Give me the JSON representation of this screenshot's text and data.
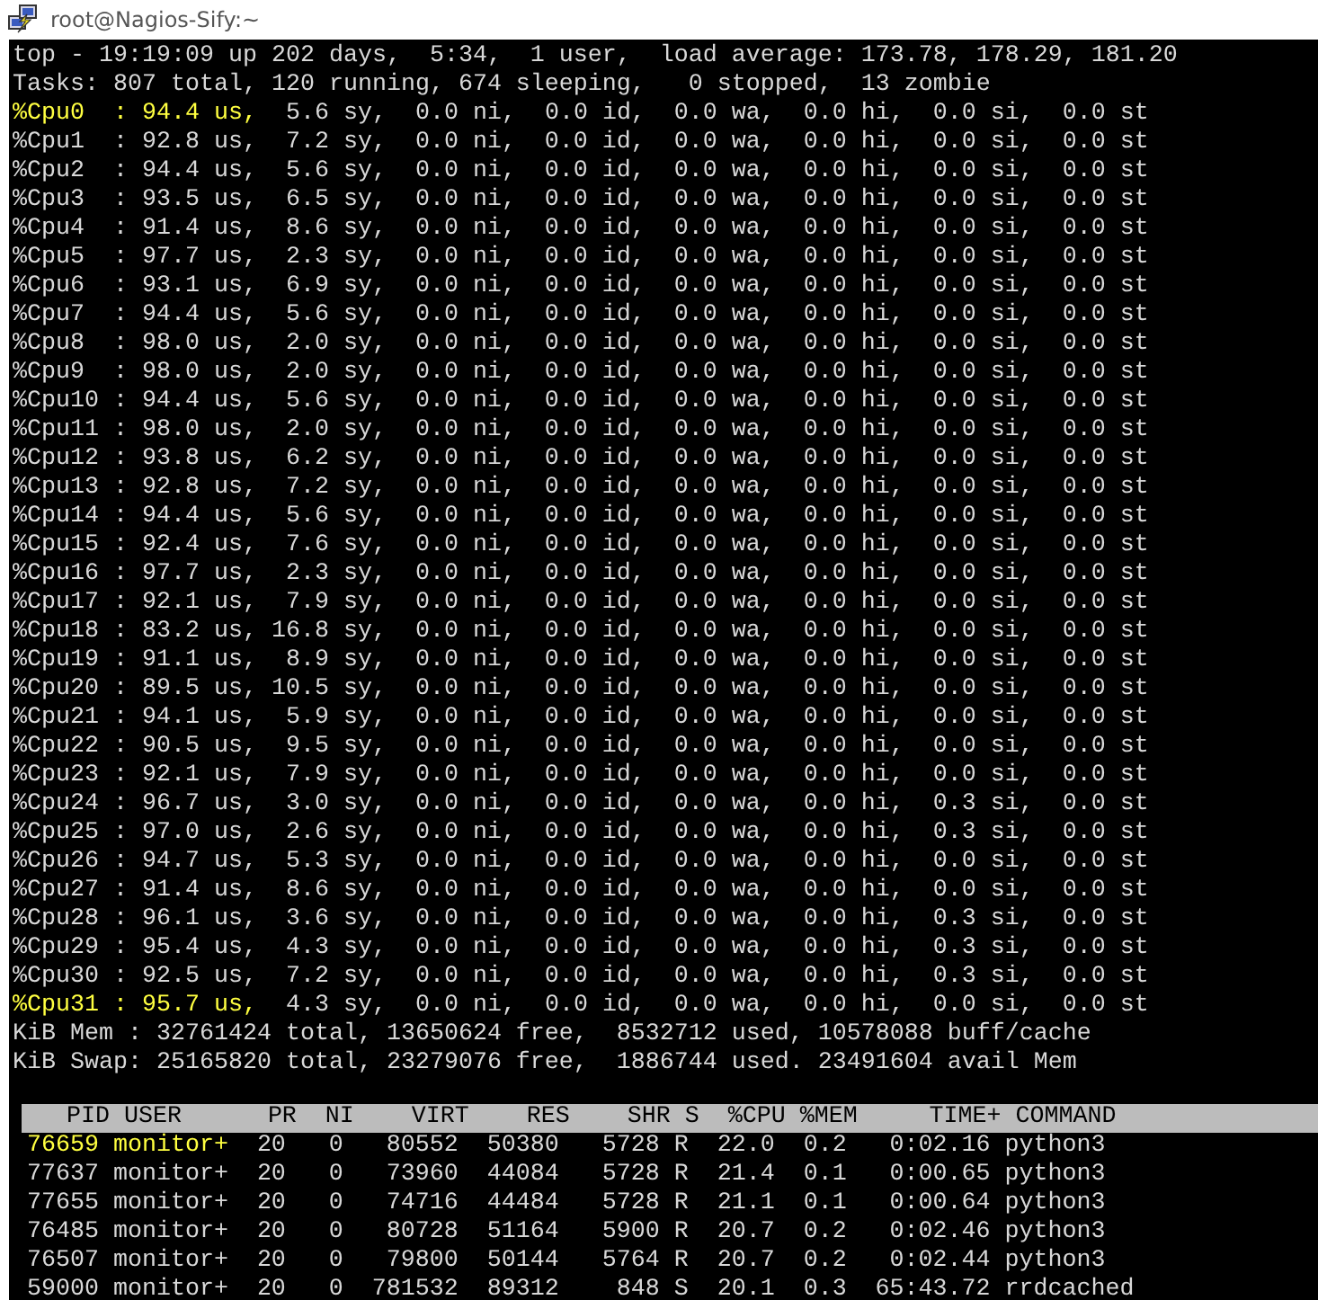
{
  "window": {
    "title": "root@Nagios-Sify:~"
  },
  "summary_lines": [
    {
      "segments": [
        {
          "text": "top - 19:19:09 up 202 days,  5:34,  1 user,  load average: 173.78, 178.29, 181.20",
          "highlighted": false
        }
      ]
    },
    {
      "segments": [
        {
          "text": "Tasks: 807 total, 120 running, 674 sleeping,   0 stopped,  13 zombie",
          "highlighted": false
        }
      ]
    },
    {
      "segments": [
        {
          "text": "%Cpu0  : 94.4 us,",
          "highlighted": true
        },
        {
          "text": "  5.6 sy,  0.0 ni,  0.0 id,  0.0 wa,  0.0 hi,  0.0 si,  0.0 st",
          "highlighted": false
        }
      ]
    },
    {
      "segments": [
        {
          "text": "%Cpu1  : 92.8 us,  7.2 sy,  0.0 ni,  0.0 id,  0.0 wa,  0.0 hi,  0.0 si,  0.0 st",
          "highlighted": false
        }
      ]
    },
    {
      "segments": [
        {
          "text": "%Cpu2  : 94.4 us,  5.6 sy,  0.0 ni,  0.0 id,  0.0 wa,  0.0 hi,  0.0 si,  0.0 st",
          "highlighted": false
        }
      ]
    },
    {
      "segments": [
        {
          "text": "%Cpu3  : 93.5 us,  6.5 sy,  0.0 ni,  0.0 id,  0.0 wa,  0.0 hi,  0.0 si,  0.0 st",
          "highlighted": false
        }
      ]
    },
    {
      "segments": [
        {
          "text": "%Cpu4  : 91.4 us,  8.6 sy,  0.0 ni,  0.0 id,  0.0 wa,  0.0 hi,  0.0 si,  0.0 st",
          "highlighted": false
        }
      ]
    },
    {
      "segments": [
        {
          "text": "%Cpu5  : 97.7 us,  2.3 sy,  0.0 ni,  0.0 id,  0.0 wa,  0.0 hi,  0.0 si,  0.0 st",
          "highlighted": false
        }
      ]
    },
    {
      "segments": [
        {
          "text": "%Cpu6  : 93.1 us,  6.9 sy,  0.0 ni,  0.0 id,  0.0 wa,  0.0 hi,  0.0 si,  0.0 st",
          "highlighted": false
        }
      ]
    },
    {
      "segments": [
        {
          "text": "%Cpu7  : 94.4 us,  5.6 sy,  0.0 ni,  0.0 id,  0.0 wa,  0.0 hi,  0.0 si,  0.0 st",
          "highlighted": false
        }
      ]
    },
    {
      "segments": [
        {
          "text": "%Cpu8  : 98.0 us,  2.0 sy,  0.0 ni,  0.0 id,  0.0 wa,  0.0 hi,  0.0 si,  0.0 st",
          "highlighted": false
        }
      ]
    },
    {
      "segments": [
        {
          "text": "%Cpu9  : 98.0 us,  2.0 sy,  0.0 ni,  0.0 id,  0.0 wa,  0.0 hi,  0.0 si,  0.0 st",
          "highlighted": false
        }
      ]
    },
    {
      "segments": [
        {
          "text": "%Cpu10 : 94.4 us,  5.6 sy,  0.0 ni,  0.0 id,  0.0 wa,  0.0 hi,  0.0 si,  0.0 st",
          "highlighted": false
        }
      ]
    },
    {
      "segments": [
        {
          "text": "%Cpu11 : 98.0 us,  2.0 sy,  0.0 ni,  0.0 id,  0.0 wa,  0.0 hi,  0.0 si,  0.0 st",
          "highlighted": false
        }
      ]
    },
    {
      "segments": [
        {
          "text": "%Cpu12 : 93.8 us,  6.2 sy,  0.0 ni,  0.0 id,  0.0 wa,  0.0 hi,  0.0 si,  0.0 st",
          "highlighted": false
        }
      ]
    },
    {
      "segments": [
        {
          "text": "%Cpu13 : 92.8 us,  7.2 sy,  0.0 ni,  0.0 id,  0.0 wa,  0.0 hi,  0.0 si,  0.0 st",
          "highlighted": false
        }
      ]
    },
    {
      "segments": [
        {
          "text": "%Cpu14 : 94.4 us,  5.6 sy,  0.0 ni,  0.0 id,  0.0 wa,  0.0 hi,  0.0 si,  0.0 st",
          "highlighted": false
        }
      ]
    },
    {
      "segments": [
        {
          "text": "%Cpu15 : 92.4 us,  7.6 sy,  0.0 ni,  0.0 id,  0.0 wa,  0.0 hi,  0.0 si,  0.0 st",
          "highlighted": false
        }
      ]
    },
    {
      "segments": [
        {
          "text": "%Cpu16 : 97.7 us,  2.3 sy,  0.0 ni,  0.0 id,  0.0 wa,  0.0 hi,  0.0 si,  0.0 st",
          "highlighted": false
        }
      ]
    },
    {
      "segments": [
        {
          "text": "%Cpu17 : 92.1 us,  7.9 sy,  0.0 ni,  0.0 id,  0.0 wa,  0.0 hi,  0.0 si,  0.0 st",
          "highlighted": false
        }
      ]
    },
    {
      "segments": [
        {
          "text": "%Cpu18 : 83.2 us, 16.8 sy,  0.0 ni,  0.0 id,  0.0 wa,  0.0 hi,  0.0 si,  0.0 st",
          "highlighted": false
        }
      ]
    },
    {
      "segments": [
        {
          "text": "%Cpu19 : 91.1 us,  8.9 sy,  0.0 ni,  0.0 id,  0.0 wa,  0.0 hi,  0.0 si,  0.0 st",
          "highlighted": false
        }
      ]
    },
    {
      "segments": [
        {
          "text": "%Cpu20 : 89.5 us, 10.5 sy,  0.0 ni,  0.0 id,  0.0 wa,  0.0 hi,  0.0 si,  0.0 st",
          "highlighted": false
        }
      ]
    },
    {
      "segments": [
        {
          "text": "%Cpu21 : 94.1 us,  5.9 sy,  0.0 ni,  0.0 id,  0.0 wa,  0.0 hi,  0.0 si,  0.0 st",
          "highlighted": false
        }
      ]
    },
    {
      "segments": [
        {
          "text": "%Cpu22 : 90.5 us,  9.5 sy,  0.0 ni,  0.0 id,  0.0 wa,  0.0 hi,  0.0 si,  0.0 st",
          "highlighted": false
        }
      ]
    },
    {
      "segments": [
        {
          "text": "%Cpu23 : 92.1 us,  7.9 sy,  0.0 ni,  0.0 id,  0.0 wa,  0.0 hi,  0.0 si,  0.0 st",
          "highlighted": false
        }
      ]
    },
    {
      "segments": [
        {
          "text": "%Cpu24 : 96.7 us,  3.0 sy,  0.0 ni,  0.0 id,  0.0 wa,  0.0 hi,  0.3 si,  0.0 st",
          "highlighted": false
        }
      ]
    },
    {
      "segments": [
        {
          "text": "%Cpu25 : 97.0 us,  2.6 sy,  0.0 ni,  0.0 id,  0.0 wa,  0.0 hi,  0.3 si,  0.0 st",
          "highlighted": false
        }
      ]
    },
    {
      "segments": [
        {
          "text": "%Cpu26 : 94.7 us,  5.3 sy,  0.0 ni,  0.0 id,  0.0 wa,  0.0 hi,  0.0 si,  0.0 st",
          "highlighted": false
        }
      ]
    },
    {
      "segments": [
        {
          "text": "%Cpu27 : 91.4 us,  8.6 sy,  0.0 ni,  0.0 id,  0.0 wa,  0.0 hi,  0.0 si,  0.0 st",
          "highlighted": false
        }
      ]
    },
    {
      "segments": [
        {
          "text": "%Cpu28 : 96.1 us,  3.6 sy,  0.0 ni,  0.0 id,  0.0 wa,  0.0 hi,  0.3 si,  0.0 st",
          "highlighted": false
        }
      ]
    },
    {
      "segments": [
        {
          "text": "%Cpu29 : 95.4 us,  4.3 sy,  0.0 ni,  0.0 id,  0.0 wa,  0.0 hi,  0.3 si,  0.0 st",
          "highlighted": false
        }
      ]
    },
    {
      "segments": [
        {
          "text": "%Cpu30 : 92.5 us,  7.2 sy,  0.0 ni,  0.0 id,  0.0 wa,  0.0 hi,  0.3 si,  0.0 st",
          "highlighted": false
        }
      ]
    },
    {
      "segments": [
        {
          "text": "%Cpu31 : 95.7 us,",
          "highlighted": true
        },
        {
          "text": "  4.3 sy,  0.0 ni,  0.0 id,  0.0 wa,  0.0 hi,  0.0 si,  0.0 st",
          "highlighted": false
        }
      ]
    },
    {
      "segments": [
        {
          "text": "KiB Mem : 32761424 total, 13650624 free,  8532712 used, 10578088 buff/cache",
          "highlighted": false
        }
      ]
    },
    {
      "segments": [
        {
          "text": "KiB Swap: 25165820 total, 23279076 free,  1886744 used. 23491604 avail Mem",
          "highlighted": false
        }
      ]
    }
  ],
  "process_table": {
    "columns": [
      "PID",
      "USER",
      "PR",
      "NI",
      "VIRT",
      "RES",
      "SHR",
      "S",
      "%CPU",
      "%MEM",
      "TIME+",
      "COMMAND"
    ],
    "rows": [
      {
        "highlighted": true,
        "cells": [
          "76659",
          "monitor+",
          "20",
          "0",
          "80552",
          "50380",
          "5728",
          "R",
          "22.0",
          "0.2",
          "0:02.16",
          "python3"
        ]
      },
      {
        "highlighted": false,
        "cells": [
          "77637",
          "monitor+",
          "20",
          "0",
          "73960",
          "44084",
          "5728",
          "R",
          "21.4",
          "0.1",
          "0:00.65",
          "python3"
        ]
      },
      {
        "highlighted": false,
        "cells": [
          "77655",
          "monitor+",
          "20",
          "0",
          "74716",
          "44484",
          "5728",
          "R",
          "21.1",
          "0.1",
          "0:00.64",
          "python3"
        ]
      },
      {
        "highlighted": false,
        "cells": [
          "76485",
          "monitor+",
          "20",
          "0",
          "80728",
          "51164",
          "5900",
          "R",
          "20.7",
          "0.2",
          "0:02.46",
          "python3"
        ]
      },
      {
        "highlighted": false,
        "cells": [
          "76507",
          "monitor+",
          "20",
          "0",
          "79800",
          "50144",
          "5764",
          "R",
          "20.7",
          "0.2",
          "0:02.44",
          "python3"
        ]
      },
      {
        "highlighted": false,
        "cells": [
          "59000",
          "monitor+",
          "20",
          "0",
          "781532",
          "89312",
          "848",
          "S",
          "20.1",
          "0.3",
          "65:43.72",
          "rrdcached"
        ]
      }
    ]
  }
}
